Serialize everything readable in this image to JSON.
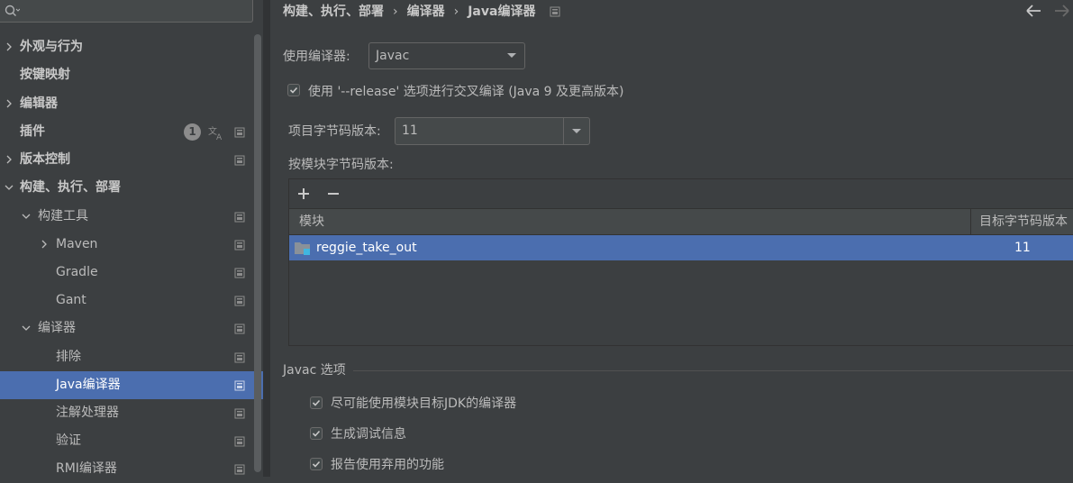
{
  "search": {
    "placeholder": ""
  },
  "sidebar": {
    "items": [
      {
        "label": "外观与行为"
      },
      {
        "label": "按键映射"
      },
      {
        "label": "编辑器"
      },
      {
        "label": "插件",
        "badge": "1"
      },
      {
        "label": "版本控制"
      },
      {
        "label": "构建、执行、部署"
      },
      {
        "label": "构建工具"
      },
      {
        "label": "Maven"
      },
      {
        "label": "Gradle"
      },
      {
        "label": "Gant"
      },
      {
        "label": "编译器"
      },
      {
        "label": "排除"
      },
      {
        "label": "Java编译器"
      },
      {
        "label": "注解处理器"
      },
      {
        "label": "验证"
      },
      {
        "label": "RMI编译器"
      }
    ]
  },
  "breadcrumb": {
    "items": [
      "构建、执行、部署",
      "编译器",
      "Java编译器"
    ],
    "separator": "›"
  },
  "settings": {
    "compiler_label": "使用编译器:",
    "compiler_value": "Javac",
    "release_checkbox_label": "使用 '--release' 选项进行交叉编译 (Java 9 及更高版本)",
    "release_checked": true,
    "bytecode_label": "项目字节码版本:",
    "bytecode_value": "11",
    "per_module_label": "按模块字节码版本:"
  },
  "module_table": {
    "add_icon": "plus-icon",
    "remove_icon": "minus-icon",
    "columns": [
      "模块",
      "目标字节码版本"
    ],
    "rows": [
      {
        "module": "reggie_take_out",
        "target": "11"
      }
    ]
  },
  "javac_options": {
    "title": "Javac 选项",
    "options": [
      {
        "label": "尽可能使用模块目标JDK的编译器",
        "checked": true
      },
      {
        "label": "生成调试信息",
        "checked": true
      },
      {
        "label": "报告使用弃用的功能",
        "checked": true
      }
    ]
  },
  "colors": {
    "background": "#3c3f41",
    "selection": "#4b6eaf",
    "text": "#bbbbbb"
  }
}
